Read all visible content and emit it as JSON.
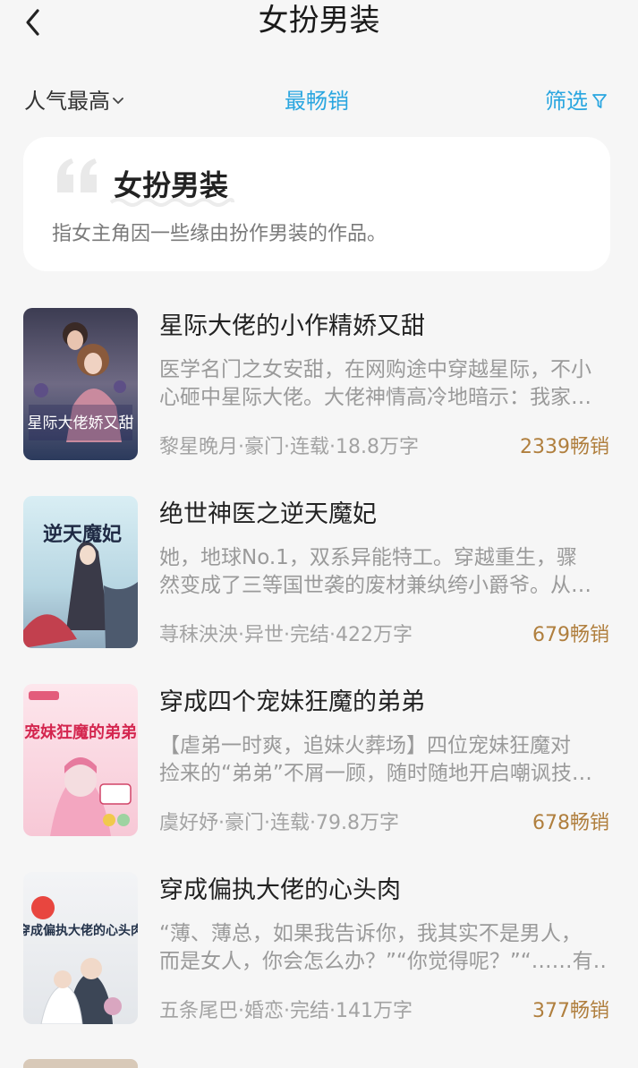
{
  "header": {
    "title": "女扮男装",
    "back_icon": "back-icon"
  },
  "sort": {
    "left_label": "人气最高",
    "middle_label": "最畅销",
    "right_label": "筛选"
  },
  "description_card": {
    "title": "女扮男装",
    "text": "指女主角因一些缘由扮作男装的作品。"
  },
  "books": [
    {
      "title": "星际大佬的小作精娇又甜",
      "desc_line1": "医学名门之女安甜，在网购途中穿越星际，不小",
      "desc_line2": "心砸中星际大佬。大佬神情高冷地暗示：我家…",
      "meta": "黎星晚月·豪门·连载·18.8万字",
      "sales": "2339畅销",
      "cover_text": "星际大佬娇又甜"
    },
    {
      "title": "绝世神医之逆天魔妃",
      "desc_line1": "她，地球No.1，双系异能特工。穿越重生，骤",
      "desc_line2": "然变成了三等国世袭的废材兼纨绔小爵爷。从…",
      "meta": "荨秣泱泱·异世·完结·422万字",
      "sales": "679畅销",
      "cover_text": "逆天魔妃"
    },
    {
      "title": "穿成四个宠妹狂魔的弟弟",
      "desc_line1": "【虐弟一时爽，追妹火葬场】四位宠妹狂魔对",
      "desc_line2": "捡来的“弟弟”不屑一顾，随时随地开启嘲讽技…",
      "meta": "虞好妤·豪门·连载·79.8万字",
      "sales": "678畅销",
      "cover_text": "宠妹狂魔的弟弟"
    },
    {
      "title": "穿成偏执大佬的心头肉",
      "desc_line1": "“薄、薄总，如果我告诉你，我其实不是男人，",
      "desc_line2": "而是女人，你会怎么办？”“你觉得呢？”“……有…",
      "meta": "五条尾巴·婚恋·完结·141万字",
      "sales": "377畅销",
      "cover_text": "穿成偏执大佬的心头肉"
    }
  ],
  "colors": {
    "accent": "#2aa6e0",
    "sales": "#b07f3e",
    "background": "#f6f6f6"
  }
}
